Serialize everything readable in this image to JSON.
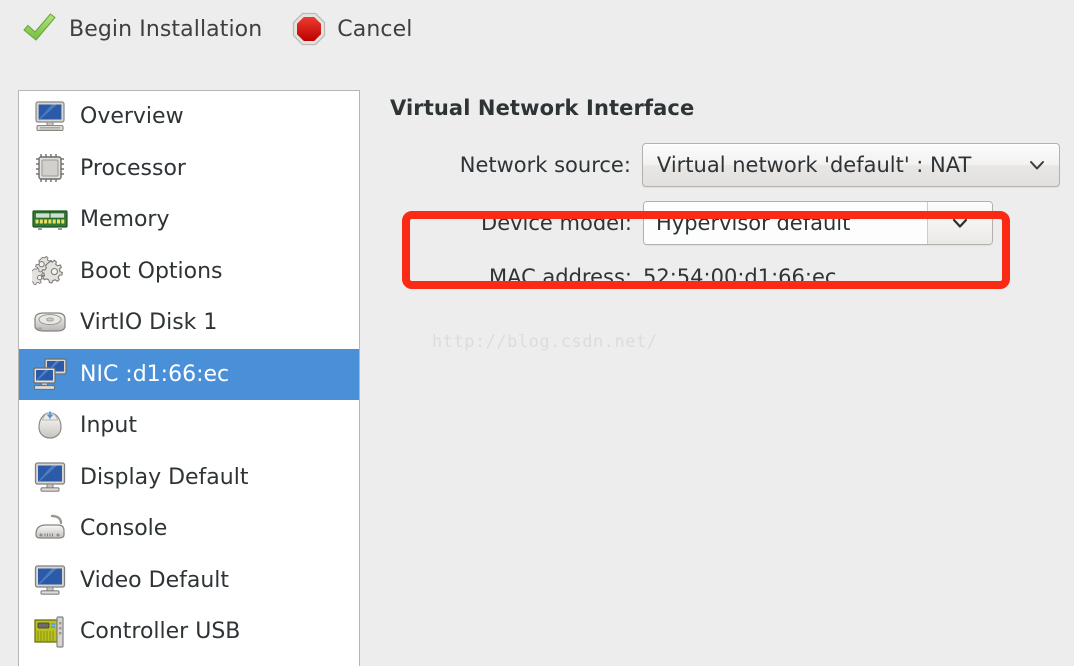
{
  "toolbar": {
    "begin_installation": {
      "label": "Begin Installation",
      "icon": "green-check-icon"
    },
    "cancel": {
      "label": "Cancel",
      "icon": "red-stop-icon"
    }
  },
  "sidebar": {
    "items": [
      {
        "label": "Overview",
        "icon": "computer-monitor-icon",
        "selected": false
      },
      {
        "label": "Processor",
        "icon": "cpu-chip-icon",
        "selected": false
      },
      {
        "label": "Memory",
        "icon": "memory-ram-icon",
        "selected": false
      },
      {
        "label": "Boot Options",
        "icon": "gears-icon",
        "selected": false
      },
      {
        "label": "VirtIO Disk 1",
        "icon": "hard-disk-icon",
        "selected": false
      },
      {
        "label": "NIC :d1:66:ec",
        "icon": "network-card-icon",
        "selected": true
      },
      {
        "label": "Input",
        "icon": "mouse-icon",
        "selected": false
      },
      {
        "label": "Display Default",
        "icon": "display-monitor-icon",
        "selected": false
      },
      {
        "label": "Console",
        "icon": "console-cable-icon",
        "selected": false
      },
      {
        "label": "Video Default",
        "icon": "display-monitor-icon",
        "selected": false
      },
      {
        "label": "Controller USB",
        "icon": "pci-card-icon",
        "selected": false
      }
    ],
    "selected_index": 5
  },
  "panel": {
    "title": "Virtual Network Interface",
    "network_source": {
      "label": "Network source:",
      "value": "Virtual network 'default' : NAT"
    },
    "device_model": {
      "label": "Device model:",
      "value": "Hypervisor default"
    },
    "mac_address": {
      "label": "MAC address:",
      "value": "52:54:00:d1:66:ec"
    }
  },
  "annotation": {
    "highlight_color": "#fa2a15",
    "target": "device-model-row"
  },
  "watermark": {
    "text": "http://blog.csdn.net/"
  },
  "colors": {
    "background": "#ededed",
    "selection_blue": "#4a90d9",
    "list_background": "#ffffff",
    "text": "#2e3436",
    "border": "#b6b6b3"
  }
}
